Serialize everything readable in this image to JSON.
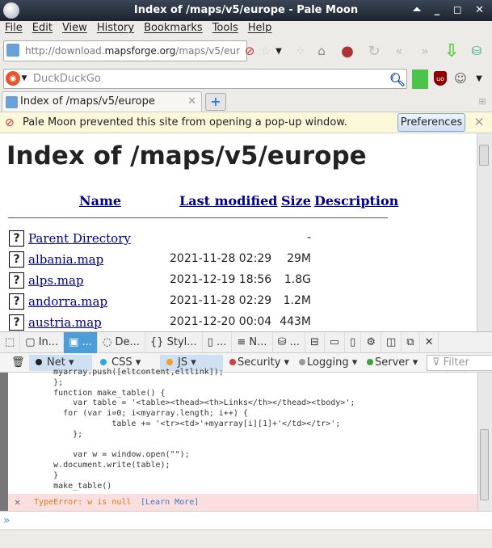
{
  "window": {
    "title": "Index of /maps/v5/europe - Pale Moon",
    "controls": "⏶ _ ◻ ✕"
  },
  "menu": [
    "File",
    "Edit",
    "View",
    "History",
    "Bookmarks",
    "Tools",
    "Help"
  ],
  "url": {
    "prefix": "http://download.",
    "domain": "mapsforge.org",
    "path": "/maps/v5/eur"
  },
  "search": {
    "placeholder": "DuckDuckGo"
  },
  "tab": {
    "title": "Index of /maps/v5/europe",
    "new_tab": "+"
  },
  "notification": {
    "text": "Pale Moon prevented this site from opening a pop-up window.",
    "button": "Preferences"
  },
  "page": {
    "heading": "Index of /maps/v5/europe",
    "columns": [
      "Name",
      "Last modified",
      "Size",
      "Description"
    ],
    "rows": [
      {
        "name": "Parent Directory",
        "date": "",
        "size": "-"
      },
      {
        "name": "albania.map",
        "date": "2021-11-28 02:29",
        "size": "29M"
      },
      {
        "name": "alps.map",
        "date": "2021-12-19 18:56",
        "size": "1.8G"
      },
      {
        "name": "andorra.map",
        "date": "2021-11-28 02:29",
        "size": "1.2M"
      },
      {
        "name": "austria.map",
        "date": "2021-12-20 00:04",
        "size": "443M"
      }
    ]
  },
  "devtools": {
    "tabs": [
      "In...",
      "...",
      "De...",
      "Styl...",
      "...",
      "N...",
      "..."
    ],
    "filters": [
      {
        "label": "Net",
        "color": "#222222",
        "on": true
      },
      {
        "label": "CSS",
        "color": "#2fa8e0",
        "on": false
      },
      {
        "label": "JS",
        "color": "#f0a030",
        "on": true
      },
      {
        "label": "Security",
        "color": "#d84040",
        "on": false
      },
      {
        "label": "Logging",
        "color": "#999999",
        "on": false
      },
      {
        "label": "Server",
        "color": "#40a040",
        "on": false
      }
    ],
    "filter_placeholder": "Filter output",
    "code": "    myarray.push([eltcontent,eltlink]);\n    };\n    function make_table() {\n        var table = '<table><thead><th>Links</th></thead><tbody>';\n      for (var i=0; i<myarray.length; i++) {\n                table += '<tr><td>'+myarray[i][1]+'</td></tr>';\n        };\n\n        var w = window.open(\"\");\n    w.document.write(table);\n    }\n    make_table()",
    "error": "TypeError: w is null",
    "learn_more": "[Learn More]",
    "prompt": "»"
  }
}
